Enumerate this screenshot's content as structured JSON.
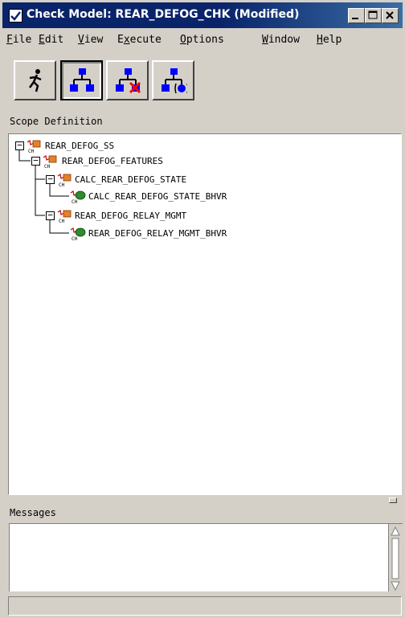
{
  "window": {
    "title": "Check Model: REAR_DEFOG_CHK (Modified)",
    "controls": [
      "minimize",
      "maximize",
      "close"
    ]
  },
  "menu": [
    {
      "label": "File",
      "mnemonic": "F",
      "rest": "ile"
    },
    {
      "label": "Edit",
      "mnemonic": "E",
      "rest": "dit"
    },
    {
      "label": "View",
      "mnemonic": "V",
      "rest": "iew"
    },
    {
      "label": "Execute",
      "pre": "E",
      "mnemonic": "x",
      "rest": "ecute"
    },
    {
      "label": "Options",
      "mnemonic": "O",
      "rest": "ptions"
    },
    {
      "label": "Window",
      "mnemonic": "W",
      "rest": "indow"
    },
    {
      "label": "Help",
      "mnemonic": "H",
      "rest": "elp"
    }
  ],
  "toolbar": {
    "tools": [
      {
        "icon": "run-icon",
        "active": false
      },
      {
        "icon": "hierarchy-icon",
        "active": true
      },
      {
        "icon": "hierarchy-delete-icon",
        "active": false
      },
      {
        "icon": "hierarchy-behavior-icon",
        "active": false
      }
    ]
  },
  "scope": {
    "label": "Scope Definition",
    "tree": [
      {
        "label": "REAR_DEFOG_SS",
        "depth": 0,
        "kind": "subsystem",
        "expanded": true
      },
      {
        "label": "REAR_DEFOG_FEATURES",
        "depth": 1,
        "kind": "subsystem",
        "expanded": true
      },
      {
        "label": "CALC_REAR_DEFOG_STATE",
        "depth": 2,
        "kind": "subsystem",
        "expanded": true
      },
      {
        "label": "CALC_REAR_DEFOG_STATE_BHVR",
        "depth": 3,
        "kind": "behavior"
      },
      {
        "label": "REAR_DEFOG_RELAY_MGMT",
        "depth": 2,
        "kind": "subsystem",
        "expanded": true
      },
      {
        "label": "REAR_DEFOG_RELAY_MGMT_BHVR",
        "depth": 3,
        "kind": "behavior"
      }
    ],
    "node_badge": "CH"
  },
  "messages": {
    "label": "Messages",
    "content": ""
  },
  "status": {
    "text": ""
  },
  "colors": {
    "title_bg": "#0a246a",
    "subsystem_icon": "#e8802a",
    "behavior_icon": "#2e8b2e",
    "link_red": "#cc0000",
    "tool_blue": "#0000ff"
  }
}
